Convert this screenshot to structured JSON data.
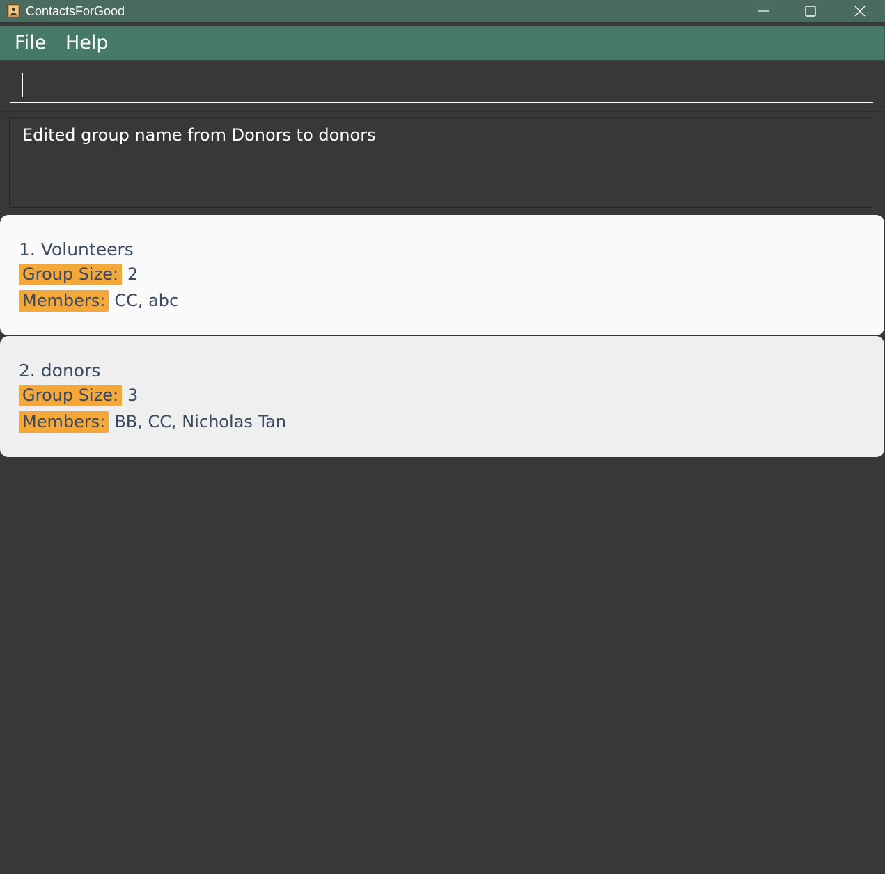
{
  "window": {
    "title": "ContactsForGood",
    "icon": "contact-book-icon",
    "controls": [
      "minimize-icon",
      "maximize-icon",
      "close-icon"
    ],
    "colors": {
      "titlebar": "#4a6b5f",
      "menubar": "#467a66",
      "background": "#383838"
    }
  },
  "menu": {
    "file_label": "File",
    "help_label": "Help"
  },
  "command": {
    "value": "",
    "placeholder": ""
  },
  "result": {
    "message": "Edited group name from Donors to donors"
  },
  "groups": [
    {
      "title": "1. Volunteers",
      "size_label": "Group Size:",
      "size_value": "2",
      "members_label": "Members:",
      "members_value": "CC, abc"
    },
    {
      "title": "2. donors",
      "size_label": "Group Size:",
      "size_value": "3",
      "members_label": "Members:",
      "members_value": "BB, CC, Nicholas Tan"
    }
  ],
  "badge_color": "#f5a83a"
}
